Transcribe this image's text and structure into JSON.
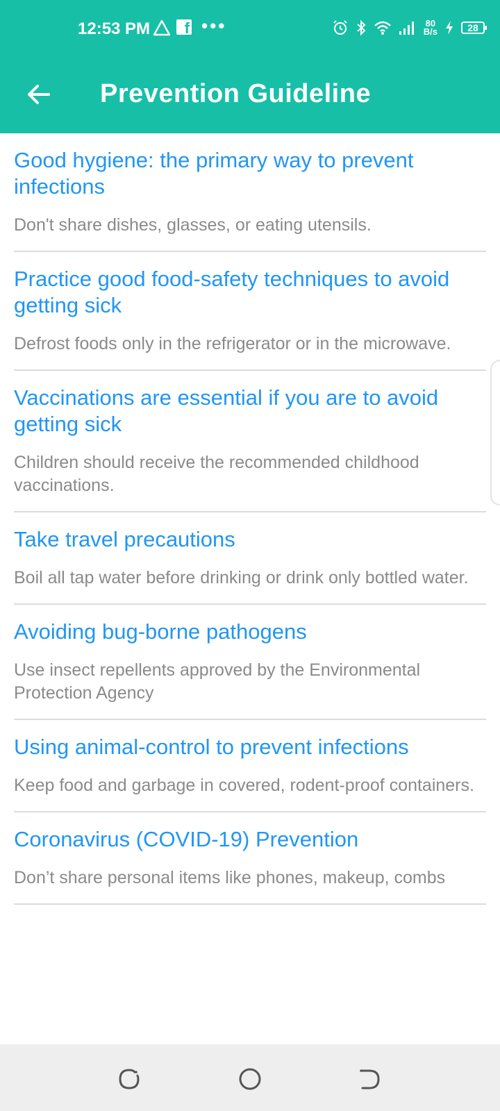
{
  "status_bar": {
    "time": "12:53 PM",
    "net_speed_value": "80",
    "net_speed_unit": "B/s",
    "battery": "28",
    "icons": [
      "warning-icon",
      "facebook-icon",
      "more-icon",
      "alarm-icon",
      "bluetooth-icon",
      "wifi-icon",
      "signal-icon",
      "charging-icon",
      "battery-icon"
    ]
  },
  "app_bar": {
    "title": "Prevention Guideline",
    "color": "#17BFA7"
  },
  "guidelines": [
    {
      "heading": "Good hygiene: the primary way to prevent infections",
      "text": "Don't share dishes, glasses, or eating utensils."
    },
    {
      "heading": "Practice good food-safety techniques to avoid getting sick",
      "text": "Defrost foods only in the refrigerator or in the microwave."
    },
    {
      "heading": "Vaccinations are essential if you are to avoid getting sick",
      "text": "Children should receive the recommended childhood vaccinations."
    },
    {
      "heading": "Take travel precautions",
      "text": "Boil all tap water before drinking or drink only bottled water."
    },
    {
      "heading": "Avoiding bug-borne pathogens",
      "text": "Use insect repellents approved by the Environmental Protection Agency"
    },
    {
      "heading": "Using animal-control to prevent infections",
      "text": "Keep food and garbage in covered, rodent-proof containers."
    },
    {
      "heading": "Coronavirus (COVID-19) Prevention",
      "text": "Don’t share personal items like phones, makeup, combs"
    }
  ],
  "colors": {
    "heading": "#2196F3",
    "body_text": "#8a8a8a",
    "divider": "#dcdcdc"
  },
  "nav_bar": {
    "buttons": [
      "recents-icon",
      "home-icon",
      "back-nav-icon"
    ]
  }
}
